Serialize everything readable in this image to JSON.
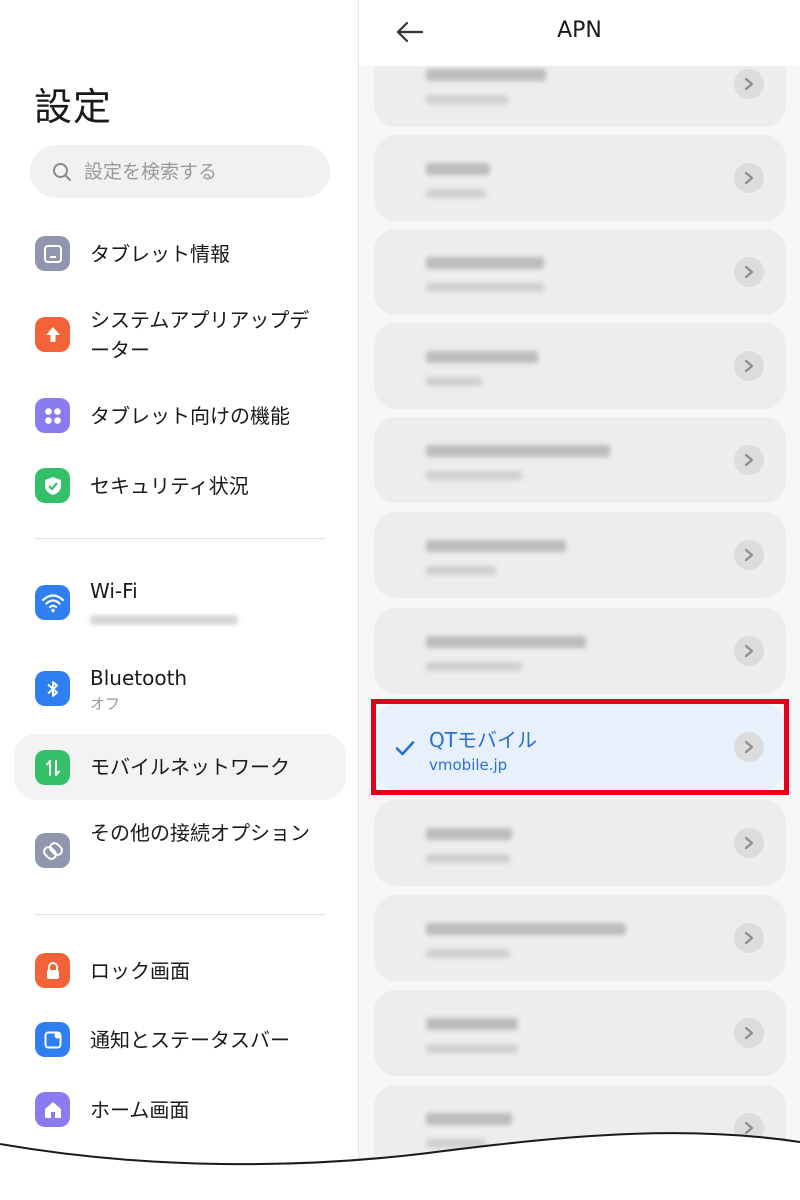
{
  "settings": {
    "title": "設定",
    "search_placeholder": "設定を検索する",
    "items": [
      {
        "label": "タブレット情報",
        "sub": ""
      },
      {
        "label": "システムアプリアップデーター",
        "sub": ""
      },
      {
        "label": "タブレット向けの機能",
        "sub": ""
      },
      {
        "label": "セキュリティ状況",
        "sub": ""
      },
      {
        "label": "Wi-Fi",
        "sub": ""
      },
      {
        "label": "Bluetooth",
        "sub": "オフ"
      },
      {
        "label": "モバイルネットワーク",
        "sub": ""
      },
      {
        "label": "その他の接続オプション",
        "sub": ""
      },
      {
        "label": "ロック画面",
        "sub": ""
      },
      {
        "label": "通知とステータスバー",
        "sub": ""
      },
      {
        "label": "ホーム画面",
        "sub": ""
      }
    ]
  },
  "apn": {
    "title": "APN",
    "selected": {
      "name": "QTモバイル",
      "apn": "vmobile.jp"
    }
  },
  "colors": {
    "accent": "#2a6fd6",
    "highlight": "#e3001b",
    "icon_info": "#8f96ad",
    "icon_update": "#f4623a",
    "icon_features": "#8a7cf0",
    "icon_security": "#34c068",
    "icon_wifi": "#2f7ff0",
    "icon_bluetooth": "#2f7ff0",
    "icon_mobile": "#34c068",
    "icon_connect": "#8f96ad",
    "icon_lock": "#f4623a",
    "icon_notif": "#2f7ff0",
    "icon_home": "#8a7cf0"
  },
  "icons": [
    "search-icon",
    "tablet-icon",
    "upload-arrow-icon",
    "grid-dots-icon",
    "shield-check-icon",
    "wifi-icon",
    "bluetooth-icon",
    "mobile-data-icon",
    "link-icon",
    "lock-icon",
    "notification-icon",
    "home-icon",
    "back-arrow-icon",
    "checkmark-icon",
    "chevron-right-icon"
  ]
}
